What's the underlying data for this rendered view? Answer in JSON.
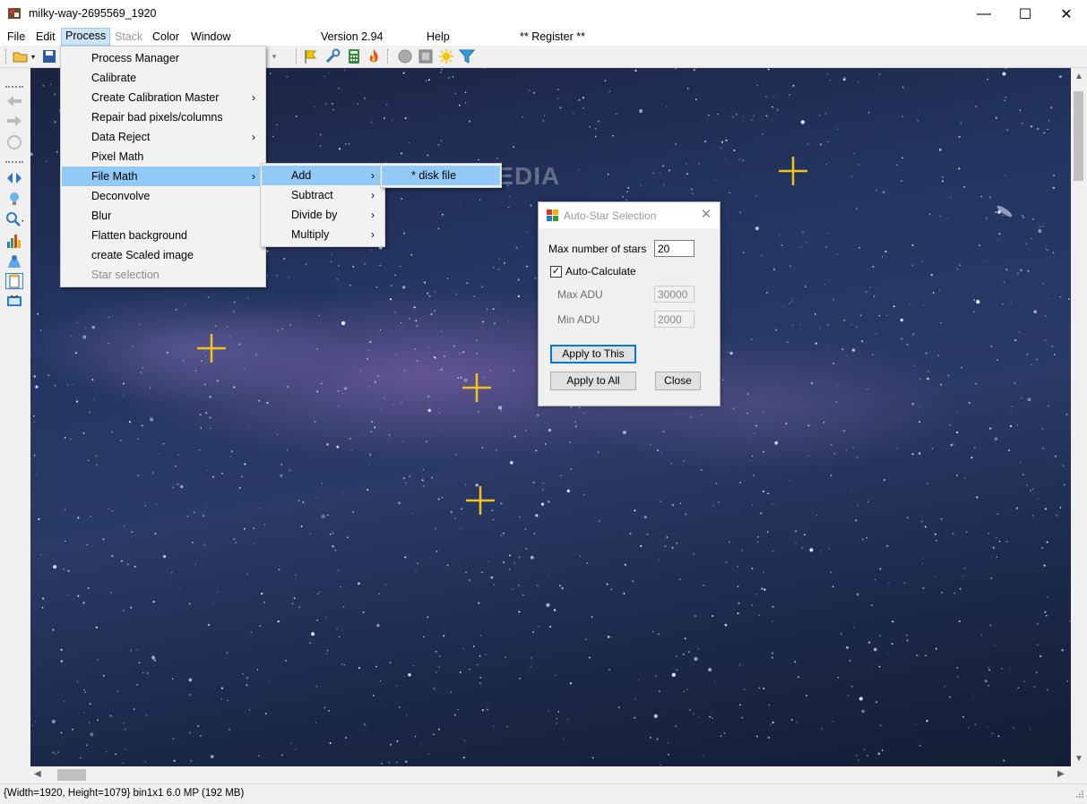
{
  "window": {
    "title": "milky-way-2695569_1920",
    "minimize": "—",
    "maximize": "☐",
    "close": "✕"
  },
  "menubar": {
    "items": [
      {
        "label": "File"
      },
      {
        "label": "Edit"
      },
      {
        "label": "Process"
      },
      {
        "label": "Stack"
      },
      {
        "label": "Color"
      },
      {
        "label": "Window"
      },
      {
        "label": "Version 2.94"
      },
      {
        "label": "Help"
      },
      {
        "label": "** Register **"
      }
    ]
  },
  "process_menu": {
    "items": [
      {
        "label": "Process Manager"
      },
      {
        "label": "Calibrate"
      },
      {
        "label": "Create Calibration Master"
      },
      {
        "label": "Repair bad pixels/columns"
      },
      {
        "label": "Data Reject"
      },
      {
        "label": "Pixel Math"
      },
      {
        "label": "File Math"
      },
      {
        "label": "Deconvolve"
      },
      {
        "label": "Blur"
      },
      {
        "label": "Flatten background"
      },
      {
        "label": "create Scaled image"
      },
      {
        "label": "Star selection"
      }
    ]
  },
  "file_math_menu": {
    "items": [
      {
        "label": "Add"
      },
      {
        "label": "Subtract"
      },
      {
        "label": "Divide by"
      },
      {
        "label": "Multiply"
      }
    ]
  },
  "add_menu": {
    "items": [
      {
        "label": "* disk file"
      }
    ]
  },
  "watermark": "SOFTPEDIA",
  "dialog": {
    "title": "Auto-Star Selection",
    "close": "✕",
    "max_stars_label": "Max number of stars",
    "max_stars_value": "20",
    "auto_calc_label": "Auto-Calculate",
    "auto_calc_checked": "✓",
    "max_adu_label": "Max ADU",
    "max_adu_value": "30000",
    "min_adu_label": "Min ADU",
    "min_adu_value": "2000",
    "apply_this": "Apply to This",
    "apply_all": "Apply to All",
    "close_button": "Close"
  },
  "status": {
    "text": "{Width=1920, Height=1079} bin1x1  6.0 MP (192 MB)"
  },
  "colors": {
    "highlight": "#91c9f7",
    "star_marker": "#f2c31a"
  }
}
